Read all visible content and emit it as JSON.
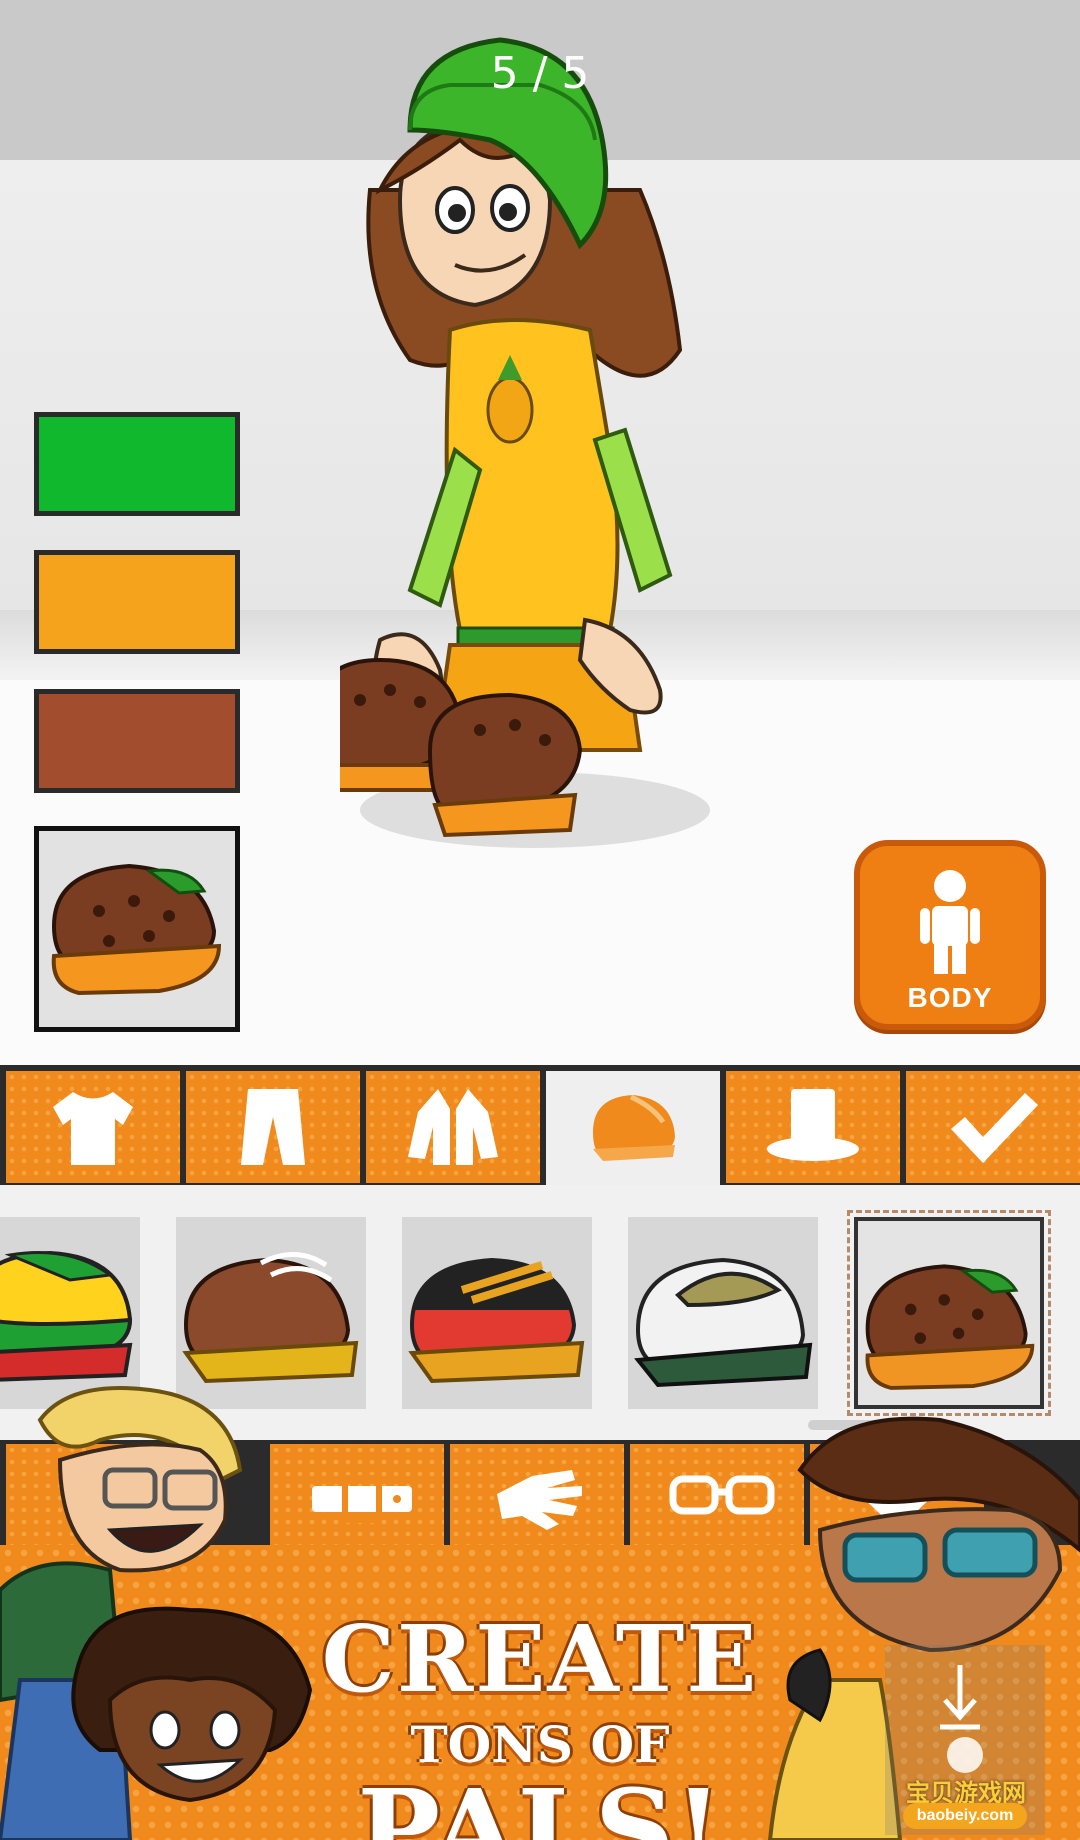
{
  "counter": "5 / 5",
  "swatches": [
    {
      "color": "#0fb82d",
      "label": "green"
    },
    {
      "color": "#f5a21c",
      "label": "orange"
    },
    {
      "color": "#a24e2e",
      "label": "brown"
    }
  ],
  "body_button": {
    "label": "BODY",
    "icon": "body-figure-icon"
  },
  "category_tabs": [
    {
      "icon": "shirt-icon",
      "active": false
    },
    {
      "icon": "pants-icon",
      "active": false
    },
    {
      "icon": "jacket-icon",
      "active": false
    },
    {
      "icon": "shoe-icon",
      "active": true
    },
    {
      "icon": "hat-icon",
      "active": false
    },
    {
      "icon": "checkmark-icon",
      "active": false
    }
  ],
  "shoe_items": [
    {
      "name": "rasta-sneaker",
      "colors": [
        "#ffd21e",
        "#1fa032",
        "#d42b2b"
      ]
    },
    {
      "name": "brown-leather-shoe",
      "colors": [
        "#8b4a2b",
        "#e3b51a",
        "#ffffff"
      ]
    },
    {
      "name": "red-black-sneaker",
      "colors": [
        "#e23a30",
        "#222222",
        "#e8a320"
      ]
    },
    {
      "name": "white-green-sneaker",
      "colors": [
        "#f2f2f2",
        "#2d5a3a",
        "#a59a55"
      ]
    },
    {
      "name": "brown-clog",
      "colors": [
        "#7a3d22",
        "#f09524",
        "#2b9b2b"
      ],
      "selected": true
    }
  ],
  "lower_tabs": [
    {
      "icon": "belt-icon"
    },
    {
      "icon": "glove-icon"
    },
    {
      "icon": "glasses-icon"
    },
    {
      "icon": "heart-icon"
    }
  ],
  "promo": {
    "line1": "CREATE",
    "line2": "TONS OF",
    "line3": "PALS!"
  },
  "watermark": {
    "text": "宝贝游戏网",
    "url": "baobeiy.com"
  }
}
